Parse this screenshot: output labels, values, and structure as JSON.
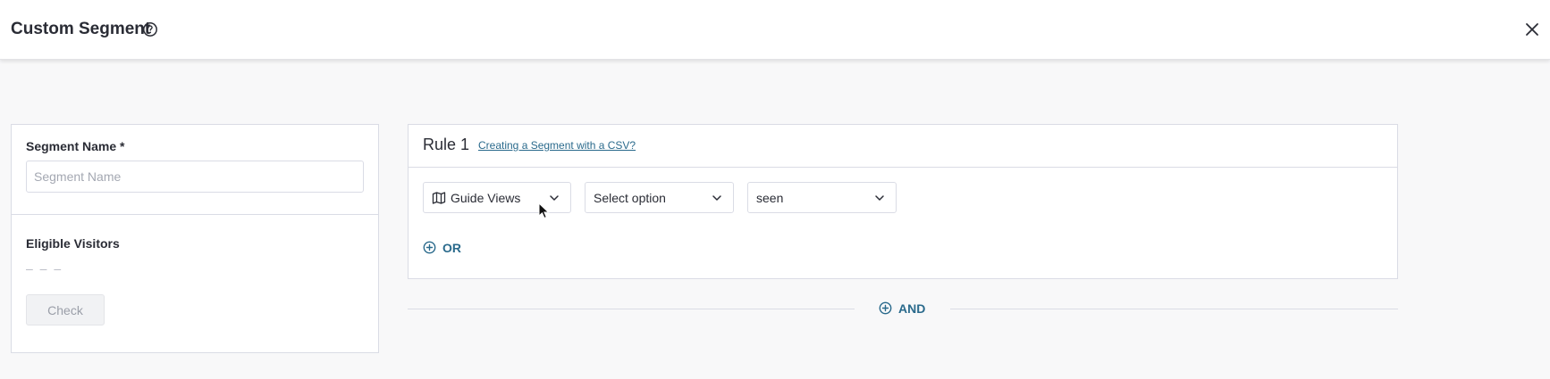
{
  "header": {
    "title": "Custom Segment",
    "help_icon": "help-circle-icon",
    "close_icon": "close-icon"
  },
  "left_panel": {
    "segment_name_label": "Segment Name *",
    "segment_name_placeholder": "Segment Name",
    "segment_name_value": "",
    "eligible_visitors_label": "Eligible Visitors",
    "eligible_visitors_value": "– – –",
    "check_label": "Check"
  },
  "rule": {
    "title": "Rule 1",
    "csv_link": "Creating a Segment with a CSV?",
    "selects": [
      {
        "icon": "map-icon",
        "value": "Guide Views"
      },
      {
        "value": "Select option"
      },
      {
        "value": "seen"
      }
    ],
    "or_label": "OR"
  },
  "and_label": "AND",
  "colors": {
    "accent": "#2a6a8c",
    "border": "#dadce5",
    "background": "#f8f8f9"
  }
}
